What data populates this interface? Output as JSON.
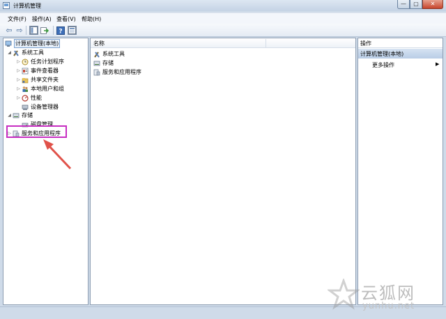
{
  "window": {
    "title": "计算机管理"
  },
  "window_controls": {
    "minimize": "—",
    "maximize": "▢",
    "close": "✕"
  },
  "menubar": {
    "items": [
      "文件(F)",
      "操作(A)",
      "查看(V)",
      "帮助(H)"
    ]
  },
  "tree": {
    "root": "计算机管理(本地)",
    "system_tools": "系统工具",
    "task_scheduler": "任务计划程序",
    "event_viewer": "事件查看器",
    "shared_folders": "共享文件夹",
    "local_users_groups": "本地用户和组",
    "performance": "性能",
    "device_manager": "设备管理器",
    "storage": "存储",
    "disk_management": "磁盘管理",
    "services_apps": "服务和应用程序"
  },
  "list": {
    "column_name": "名称",
    "rows": [
      "系统工具",
      "存储",
      "服务和应用程序"
    ]
  },
  "actions": {
    "title": "操作",
    "group": "计算机管理(本地)",
    "more": "更多操作"
  },
  "watermark": {
    "cn": "云狐网",
    "en": "yunhu.net"
  },
  "colors": {
    "annotation_box": "#c72dc1",
    "annotation_arrow": "#e0524a"
  },
  "icons": [
    "back-arrow-icon",
    "forward-arrow-icon",
    "console-tree-icon",
    "export-list-icon",
    "help-icon",
    "properties-icon",
    "computer-icon",
    "tools-icon",
    "clock-icon",
    "event-icon",
    "folder-share-icon",
    "users-icon",
    "performance-icon",
    "device-icon",
    "storage-icon",
    "disk-icon",
    "services-icon",
    "submenu-arrow-icon"
  ]
}
